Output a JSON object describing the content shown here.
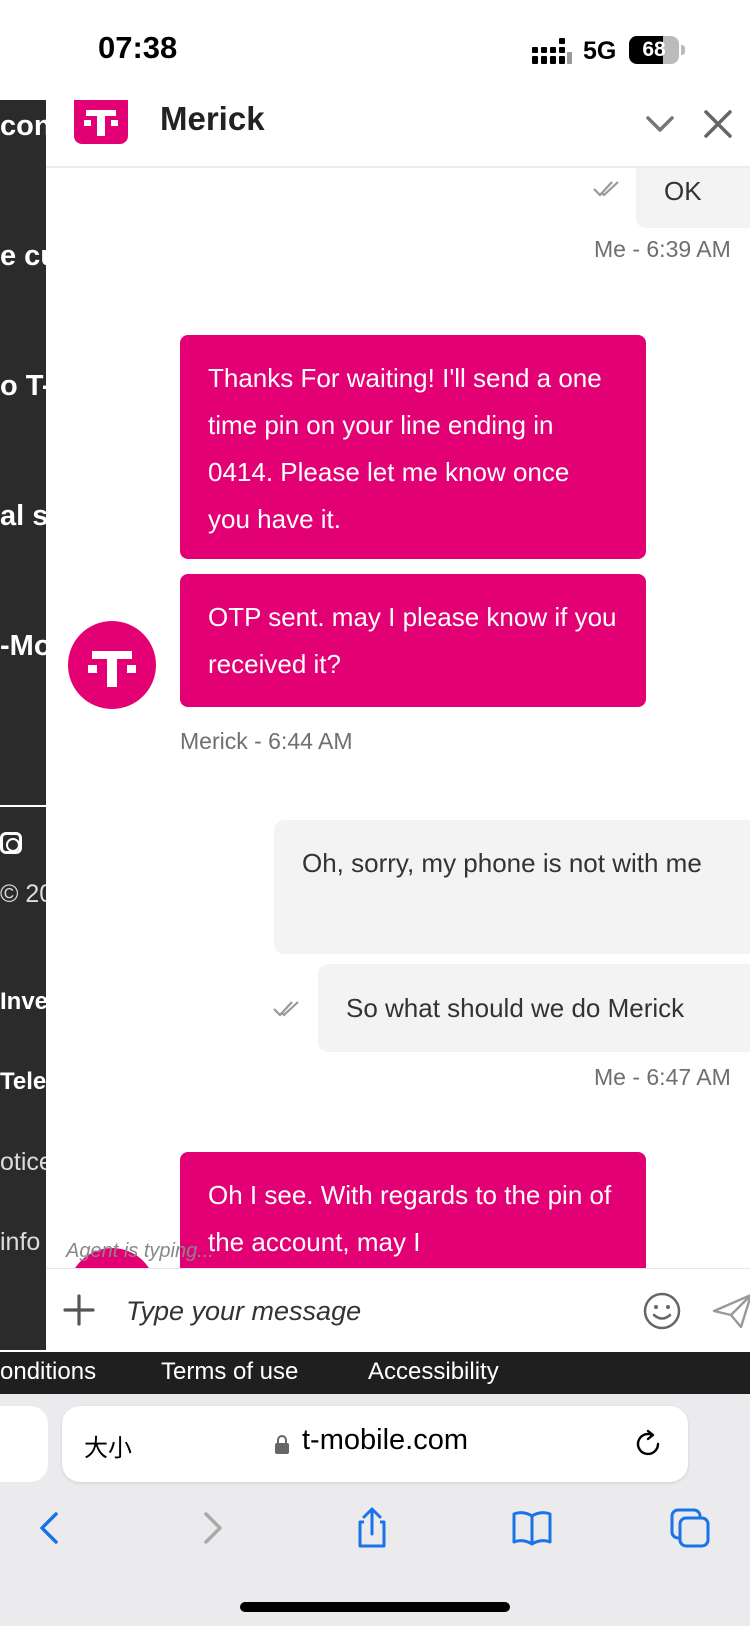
{
  "status_bar": {
    "time": "07:38",
    "network": "5G",
    "battery": "68",
    "battery_level": 0.68
  },
  "background_page": {
    "fragments": [
      "cons",
      "e cu",
      "o T-",
      "al s",
      "-Mo",
      "© 20",
      "Inve",
      "Tele",
      "otice",
      "info"
    ]
  },
  "footer_links": [
    "onditions",
    "Terms of use",
    "Accessibility"
  ],
  "chat": {
    "header": {
      "agent_name": "Merick"
    },
    "messages": [
      {
        "from": "me",
        "text": "OK"
      },
      {
        "from": "meta",
        "text": "Me - 6:39 AM"
      },
      {
        "from": "agent",
        "text": "Thanks For waiting! I'll send a one time pin on your line ending in 0414. Please let me know once you have it."
      },
      {
        "from": "agent",
        "text": "OTP sent. may I please know if you received it?"
      },
      {
        "from": "meta",
        "text": "Merick - 6:44 AM"
      },
      {
        "from": "me",
        "text": "Oh, sorry, my phone is not with me"
      },
      {
        "from": "me",
        "text": "So what should we do Merick"
      },
      {
        "from": "meta",
        "text": "Me - 6:47 AM"
      },
      {
        "from": "agent",
        "text": "Oh I see. With regards to the pin of the account, may I"
      }
    ],
    "typing_indicator": "Agent is typing...",
    "composer": {
      "placeholder": "Type your message"
    }
  },
  "browser": {
    "text_size_label": "大小",
    "url": "t-mobile.com"
  },
  "colors": {
    "brand": "#e20074",
    "me_bubble": "#f3f3f3"
  }
}
